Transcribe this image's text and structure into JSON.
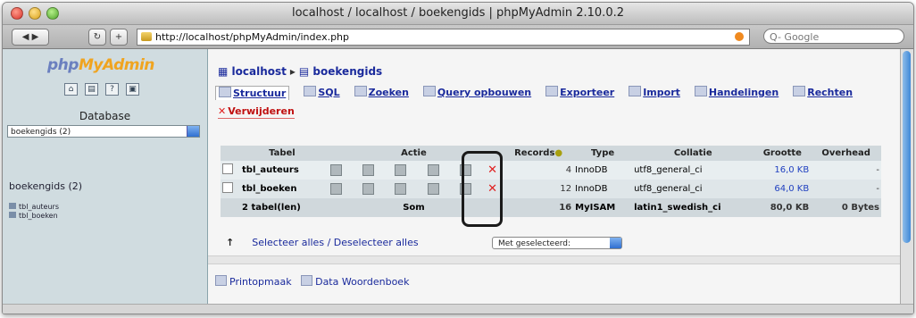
{
  "window": {
    "title": "localhost / localhost / boekengids | phpMyAdmin 2.10.0.2",
    "url": "http://localhost/phpMyAdmin/index.php",
    "search_placeholder": "Q- Google"
  },
  "sidebar": {
    "logo_php": "php",
    "logo_my": "MyAdmin",
    "database_label": "Database",
    "database_select": "boekengids (2)",
    "db_heading": "boekengids (2)",
    "tables": [
      "tbl_auteurs",
      "tbl_boeken"
    ]
  },
  "breadcrumb": {
    "server": "localhost",
    "database": "boekengids"
  },
  "tabs": [
    {
      "label": "Structuur"
    },
    {
      "label": "SQL"
    },
    {
      "label": "Zoeken"
    },
    {
      "label": "Query opbouwen"
    },
    {
      "label": "Exporteer"
    },
    {
      "label": "Import"
    },
    {
      "label": "Handelingen"
    },
    {
      "label": "Rechten"
    }
  ],
  "drop_tab": "Verwijderen",
  "table": {
    "headers": [
      "Tabel",
      "Actie",
      "Records",
      "Type",
      "Collatie",
      "Grootte",
      "Overhead"
    ],
    "rows": [
      {
        "name": "tbl_auteurs",
        "records": "4",
        "type": "InnoDB",
        "collation": "utf8_general_ci",
        "size": "16,0 KB",
        "overhead": "-"
      },
      {
        "name": "tbl_boeken",
        "records": "12",
        "type": "InnoDB",
        "collation": "utf8_general_ci",
        "size": "64,0 KB",
        "overhead": "-"
      }
    ],
    "sum": {
      "name": "2 tabel(len)",
      "label": "Som",
      "records": "16",
      "type": "MyISAM",
      "collation": "latin1_swedish_ci",
      "size": "80,0 KB",
      "overhead": "0 Bytes"
    }
  },
  "selection": {
    "select_all": "Selecteer alles",
    "separator": "/",
    "deselect_all": "Deselecteer alles",
    "with_selected": "Met geselecteerd:"
  },
  "bottom_links": {
    "print": "Printopmaak",
    "dictionary": "Data Woordenboek"
  }
}
